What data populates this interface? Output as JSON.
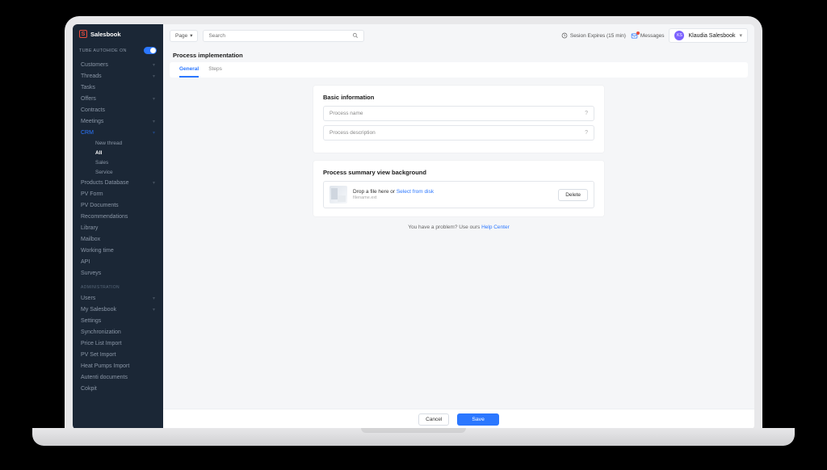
{
  "brand": "Salesbook",
  "toggle_label": "TUBE AUTOHIDE ON",
  "sidebar": {
    "items": [
      {
        "label": "Customers",
        "expandable": true
      },
      {
        "label": "Threads",
        "expandable": true
      },
      {
        "label": "Tasks",
        "expandable": false
      },
      {
        "label": "Offers",
        "expandable": true
      },
      {
        "label": "Contracts",
        "expandable": false
      },
      {
        "label": "Meetings",
        "expandable": true
      },
      {
        "label": "CRM",
        "expandable": true,
        "selected": true,
        "children": [
          {
            "label": "New thread"
          },
          {
            "label": "All",
            "active": true
          },
          {
            "label": "Sales"
          },
          {
            "label": "Service"
          }
        ]
      },
      {
        "label": "Products Database",
        "expandable": true
      },
      {
        "label": "PV Form",
        "expandable": false
      },
      {
        "label": "PV Documents",
        "expandable": false
      },
      {
        "label": "Recommendations",
        "expandable": false
      },
      {
        "label": "Library",
        "expandable": false
      },
      {
        "label": "Mailbox",
        "expandable": false
      },
      {
        "label": "Working time",
        "expandable": false
      },
      {
        "label": "API",
        "expandable": false
      },
      {
        "label": "Surveys",
        "expandable": false
      }
    ],
    "admin_label": "ADMINISTRATION",
    "admin_items": [
      {
        "label": "Users",
        "expandable": true
      },
      {
        "label": "My Salesbook",
        "expandable": true
      },
      {
        "label": "Settings",
        "expandable": false
      },
      {
        "label": "Synchronization",
        "expandable": false
      },
      {
        "label": "Price List Import",
        "expandable": false
      },
      {
        "label": "PV Set Import",
        "expandable": false
      },
      {
        "label": "Heat Pumps Import",
        "expandable": false
      },
      {
        "label": "Autenti documents",
        "expandable": false
      },
      {
        "label": "Cokpit",
        "expandable": false
      }
    ]
  },
  "topbar": {
    "scope": "Page",
    "search_placeholder": "Search",
    "session": "Sesion Expires (15 min)",
    "messages": "Messages",
    "user_initials": "KS",
    "user_name": "Klaudia Salesbook"
  },
  "page": {
    "title": "Process implementation"
  },
  "tabs": [
    {
      "label": "General",
      "active": true
    },
    {
      "label": "Steps",
      "active": false
    }
  ],
  "basic_card": {
    "title": "Basic information",
    "name_placeholder": "Process name",
    "desc_placeholder": "Process description"
  },
  "bg_card": {
    "title": "Process summary view background",
    "drop_prefix": "Drop a file here or ",
    "drop_link": "Select from disk",
    "filename": "filename.ext",
    "delete": "Delete"
  },
  "help": {
    "prefix": "You have a problem? Use ours ",
    "link": "Help Center"
  },
  "footer": {
    "cancel": "Cancel",
    "save": "Save"
  }
}
